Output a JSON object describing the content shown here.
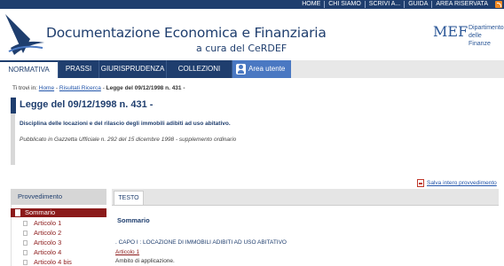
{
  "topnav": [
    "HOME",
    "CHI SIAMO",
    "SCRIVI A...",
    "GUIDA",
    "AREA RISERVATA"
  ],
  "header": {
    "title": "Documentazione Economica e Finanziaria",
    "subtitle": "a cura del CeRDEF",
    "mef": "MEF",
    "dept_line1": "Dipartimento",
    "dept_line2": "delle Finanze"
  },
  "mainnav": {
    "tabs": [
      "NORMATIVA",
      "PRASSI",
      "GIURISPRUDENZA",
      "COLLEZIONI"
    ],
    "area": "Area utente",
    "active": "NORMATIVA"
  },
  "breadcrumb": {
    "prefix": "Ti trovi in:",
    "home": "Home",
    "results": "Risultati Ricerca",
    "current": "Legge del 09/12/1998 n. 431 -"
  },
  "doc": {
    "title": "Legge del 09/12/1998 n. 431 -",
    "description": "Disciplina delle locazioni e del rilascio degli immobili adibiti ad uso abitativo.",
    "published": "Pubblicato in Gazzetta Ufficiale n. 292 del 15 dicembre 1998 - supplemento ordinario"
  },
  "save_label": "Salva intero provvedimento",
  "sidebar": {
    "heading": "Provvedimento",
    "summary": "Sommario",
    "items": [
      "Articolo 1",
      "Articolo 2",
      "Articolo 3",
      "Articolo 4",
      "Articolo 4 bis"
    ]
  },
  "content": {
    "tab": "TESTO",
    "title": "Sommario",
    "capo": ". CAPO I : LOCAZIONE DI IMMOBILI ADIBITI AD USO ABITATIVO",
    "article": "Articolo 1",
    "article_desc": "Ambito di applicazione."
  },
  "colors": {
    "navy": "#1f3e6e",
    "accent_blue": "#4a78c2",
    "sidebar_red": "#8b1a1a",
    "rss": "#f08a24"
  }
}
